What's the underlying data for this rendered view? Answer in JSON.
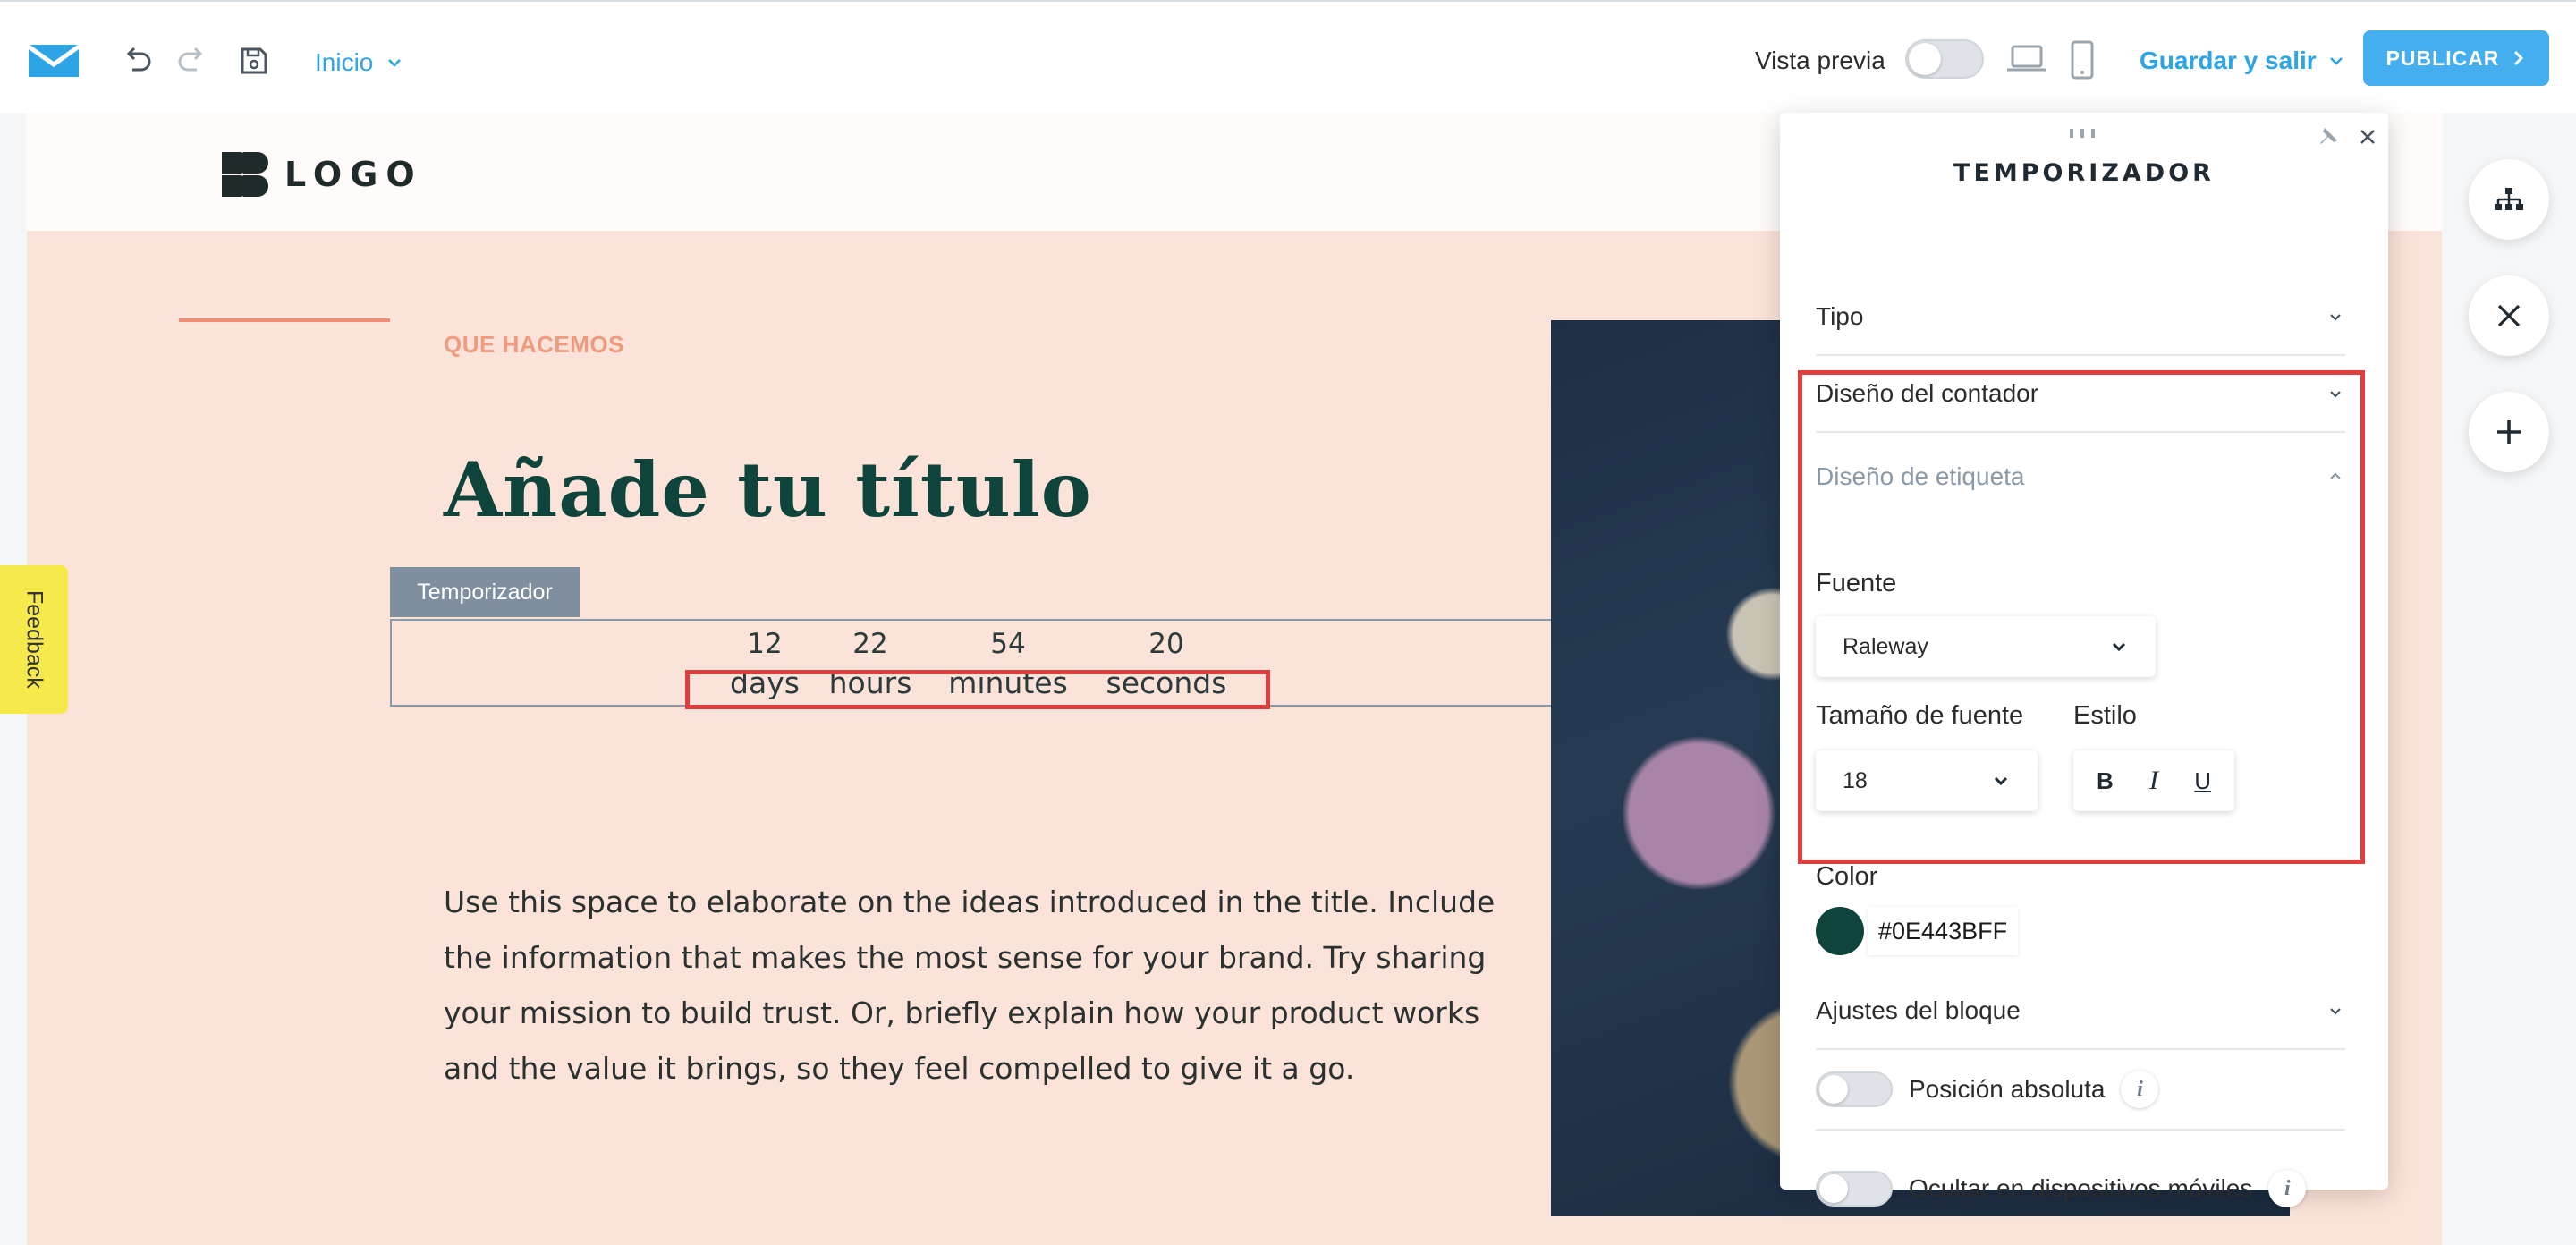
{
  "topbar": {
    "page_label": "Inicio",
    "preview_label": "Vista previa",
    "save_exit_label": "Guardar y salir",
    "publish_label": "PUBLICAR"
  },
  "site": {
    "logo_text": "LOGO",
    "eyebrow": "QUE HACEMOS",
    "headline": "Añade tu título",
    "timer_tab": "Temporizador",
    "timer": [
      {
        "value": "12",
        "label": "days"
      },
      {
        "value": "22",
        "label": "hours"
      },
      {
        "value": "54",
        "label": "minutes"
      },
      {
        "value": "20",
        "label": "seconds"
      }
    ],
    "body_lines": [
      "Use this space to elaborate on the ideas introduced in the title. Include",
      "the information that makes the most sense for your brand. Try sharing",
      "your mission to build trust. Or, briefly explain how your product works",
      "and the value it brings, so they feel compelled to give it a go."
    ]
  },
  "feedback_label": "Feedback",
  "panel": {
    "title": "TEMPORIZADOR",
    "sections": {
      "tipo": "Tipo",
      "contador": "Diseño del contador",
      "etiqueta": "Diseño de etiqueta",
      "ajustes": "Ajustes del bloque"
    },
    "font_label": "Fuente",
    "font_value": "Raleway",
    "size_label": "Tamaño de fuente",
    "size_value": "18",
    "style_label": "Estilo",
    "style_buttons": {
      "bold": "B",
      "italic": "I",
      "underline": "U"
    },
    "color_label": "Color",
    "color_value": "#0E443BFF",
    "absolute_label": "Posición absoluta",
    "hide_mobile_label": "Ocultar en dispositivos móviles",
    "info_glyph": "i"
  },
  "colors": {
    "accent_blue": "#2da4e6",
    "publish_bg": "#44aeee",
    "headline": "#0e443b",
    "highlight": "#e03e3e",
    "label_color": "#0e443b"
  },
  "icons": {
    "brand": "envelope-logo-icon",
    "undo": "undo-icon",
    "redo": "redo-icon",
    "save": "save-icon",
    "desktop": "desktop-icon",
    "mobile": "mobile-icon",
    "structure": "sitemap-icon",
    "close": "close-icon",
    "add": "plus-icon"
  }
}
